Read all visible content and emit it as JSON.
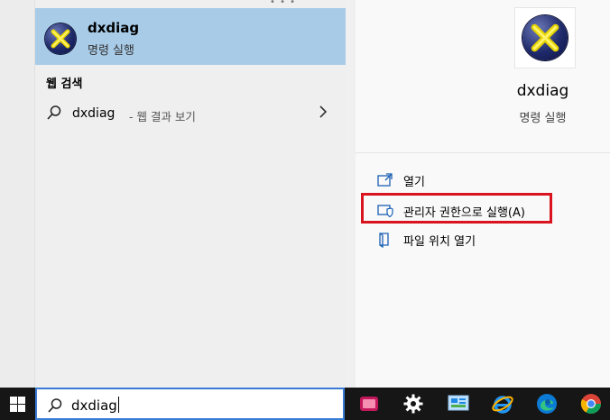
{
  "best_match": {
    "title": "dxdiag",
    "subtitle": "명령 실행"
  },
  "web_section": {
    "title": "웹 검색",
    "query": "dxdiag",
    "suffix": "- 웹 결과 보기"
  },
  "detail": {
    "title": "dxdiag",
    "subtitle": "명령 실행",
    "actions": {
      "open": "열기",
      "run_as_admin": "관리자 권한으로 실행(A)",
      "open_location": "파일 위치 열기"
    }
  },
  "search": {
    "value": "dxdiag"
  },
  "colors": {
    "selection": "#a8cbe8",
    "highlight_box": "#d9141f",
    "taskbar": "#161616",
    "search_border": "#3a7bd5"
  },
  "taskbar_icons": [
    "snip-tool-icon",
    "settings-gear-icon",
    "control-panel-icon",
    "internet-explorer-icon",
    "edge-icon",
    "chrome-icon"
  ]
}
